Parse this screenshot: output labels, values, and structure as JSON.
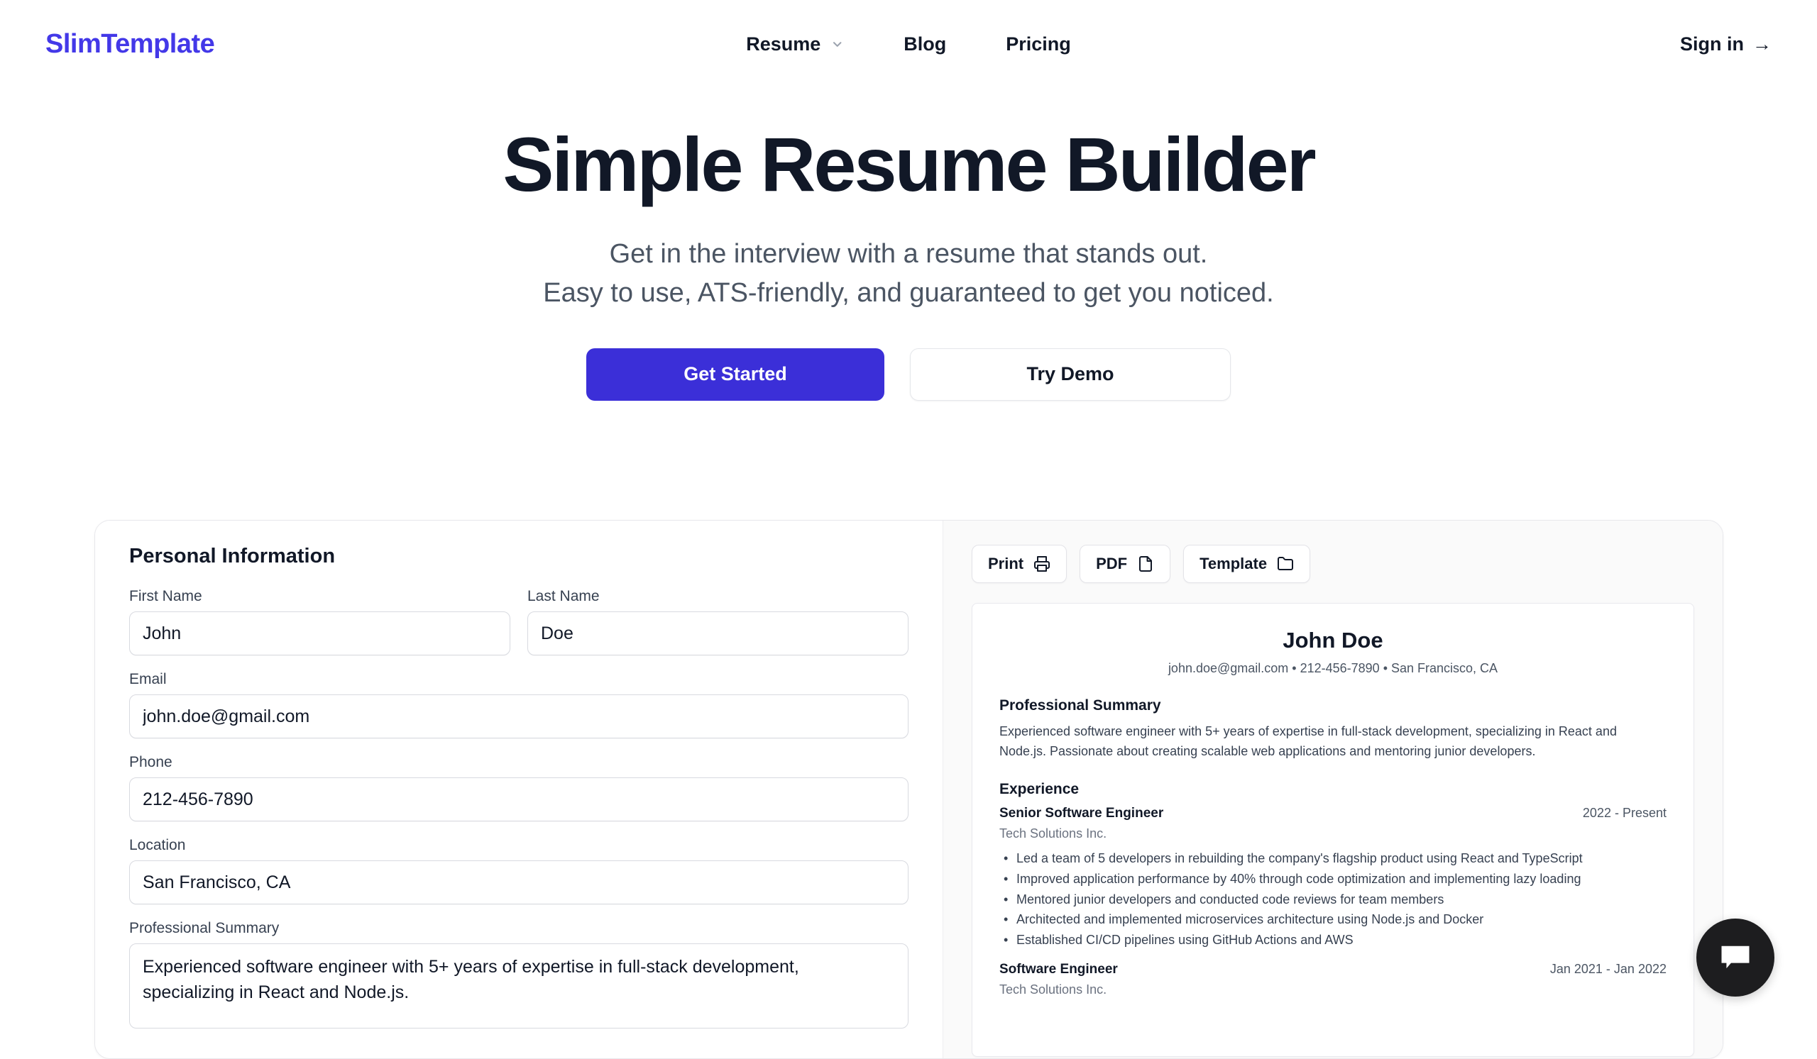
{
  "brand": {
    "name": "SlimTemplate",
    "color": "#4338e8"
  },
  "nav": {
    "items": [
      {
        "label": "Resume",
        "has_chevron": true,
        "icon": "chevron-down-icon"
      },
      {
        "label": "Blog",
        "has_chevron": false
      },
      {
        "label": "Pricing",
        "has_chevron": false
      }
    ],
    "signin_label": "Sign in",
    "signin_arrow": "→"
  },
  "hero": {
    "title": "Simple Resume Builder",
    "subtitle_line1": "Get in the interview with a resume that stands out.",
    "subtitle_line2": "Easy to use, ATS-friendly, and guaranteed to get you noticed.",
    "primary_cta": "Get Started",
    "secondary_cta": "Try Demo",
    "primary_cta_color": "#3b2fd8"
  },
  "form": {
    "section_title": "Personal Information",
    "fields": {
      "first_name": {
        "label": "First Name",
        "value": "John"
      },
      "last_name": {
        "label": "Last Name",
        "value": "Doe"
      },
      "email": {
        "label": "Email",
        "value": "john.doe@gmail.com"
      },
      "phone": {
        "label": "Phone",
        "value": "212-456-7890"
      },
      "location": {
        "label": "Location",
        "value": "San Francisco, CA"
      },
      "summary": {
        "label": "Professional Summary",
        "value": "Experienced software engineer with 5+ years of expertise in full-stack development, specializing in React and Node.js."
      }
    }
  },
  "toolbar": {
    "print_label": "Print",
    "print_icon": "printer-icon",
    "pdf_label": "PDF",
    "pdf_icon": "file-icon",
    "template_label": "Template",
    "template_icon": "folder-icon"
  },
  "resume": {
    "name": "John Doe",
    "contact": "john.doe@gmail.com • 212-456-7890 • San Francisco, CA",
    "summary_heading": "Professional Summary",
    "summary_text": "Experienced software engineer with 5+ years of expertise in full-stack development, specializing in React and Node.js. Passionate about creating scalable web applications and mentoring junior developers.",
    "experience_heading": "Experience",
    "jobs": [
      {
        "title": "Senior Software Engineer",
        "dates": "2022 - Present",
        "company": "Tech Solutions Inc.",
        "bullets": [
          "Led a team of 5 developers in rebuilding the company's flagship product using React and TypeScript",
          "Improved application performance by 40% through code optimization and implementing lazy loading",
          "Mentored junior developers and conducted code reviews for team members",
          "Architected and implemented microservices architecture using Node.js and Docker",
          "Established CI/CD pipelines using GitHub Actions and AWS"
        ]
      },
      {
        "title": "Software Engineer",
        "dates": "Jan 2021 - Jan 2022",
        "company": "Tech Solutions Inc.",
        "bullets": []
      }
    ]
  },
  "chat": {
    "icon": "chat-bubble-icon",
    "color": "#1d1d1f"
  }
}
